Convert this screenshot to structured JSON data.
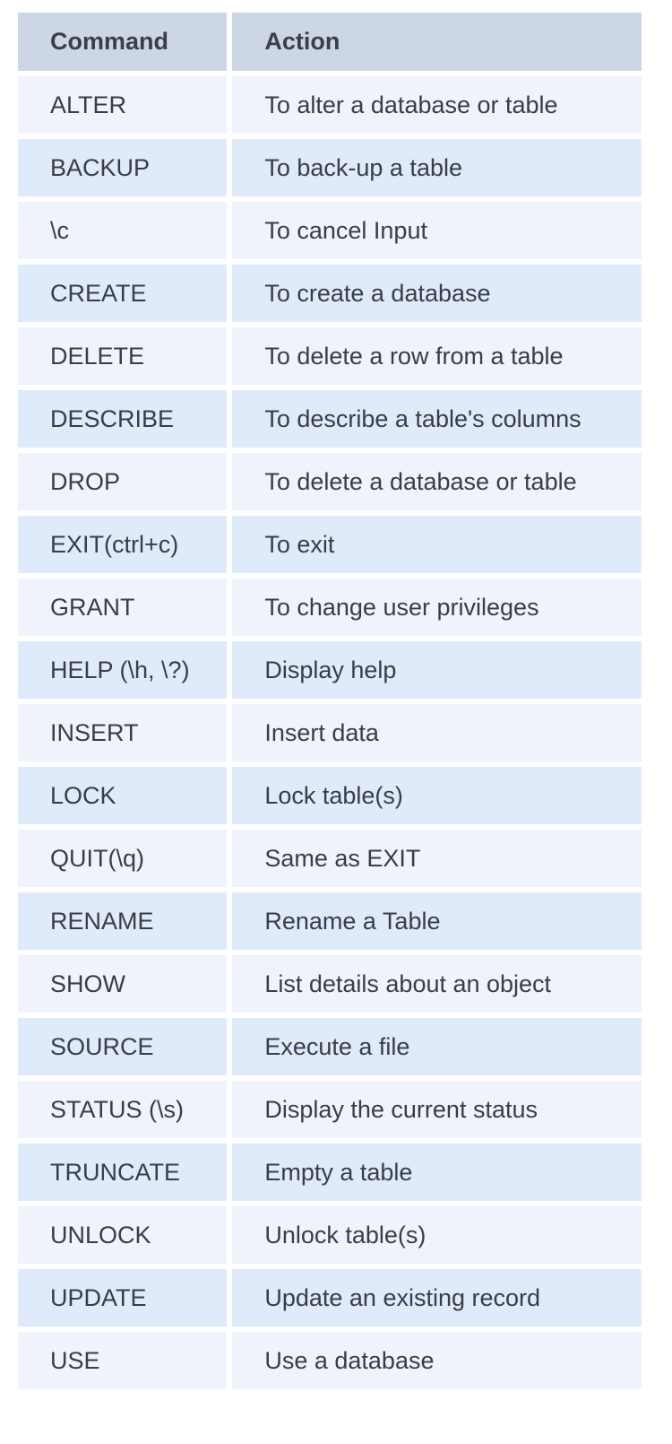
{
  "table": {
    "headers": {
      "command": "Command",
      "action": "Action"
    },
    "rows": [
      {
        "command": "ALTER",
        "action": "To alter a database or table"
      },
      {
        "command": "BACKUP",
        "action": "To back-up a table"
      },
      {
        "command": "\\c",
        "action": "To cancel Input"
      },
      {
        "command": "CREATE",
        "action": "To create a database"
      },
      {
        "command": "DELETE",
        "action": "To delete a row from a table"
      },
      {
        "command": "DESCRIBE",
        "action": "To describe a table's columns"
      },
      {
        "command": "DROP",
        "action": "To delete a database or table"
      },
      {
        "command": "EXIT(ctrl+c)",
        "action": "To exit"
      },
      {
        "command": "GRANT",
        "action": "To change user privileges"
      },
      {
        "command": "HELP (\\h, \\?)",
        "action": "Display help"
      },
      {
        "command": "INSERT",
        "action": "Insert data"
      },
      {
        "command": "LOCK",
        "action": "Lock table(s)"
      },
      {
        "command": "QUIT(\\q)",
        "action": "Same as EXIT"
      },
      {
        "command": "RENAME",
        "action": "Rename a Table"
      },
      {
        "command": "SHOW",
        "action": "List details about an object"
      },
      {
        "command": "SOURCE",
        "action": "Execute a file"
      },
      {
        "command": "STATUS (\\s)",
        "action": "Display the current status"
      },
      {
        "command": "TRUNCATE",
        "action": "Empty a table"
      },
      {
        "command": "UNLOCK",
        "action": "Unlock table(s)"
      },
      {
        "command": "UPDATE",
        "action": "Update an existing record"
      },
      {
        "command": "USE",
        "action": "Use a database"
      }
    ]
  },
  "colors": {
    "header_bg": "#ccd6e5",
    "row_light": "#eff3fc",
    "row_alt": "#dfeafa",
    "text": "#3a3d44"
  }
}
